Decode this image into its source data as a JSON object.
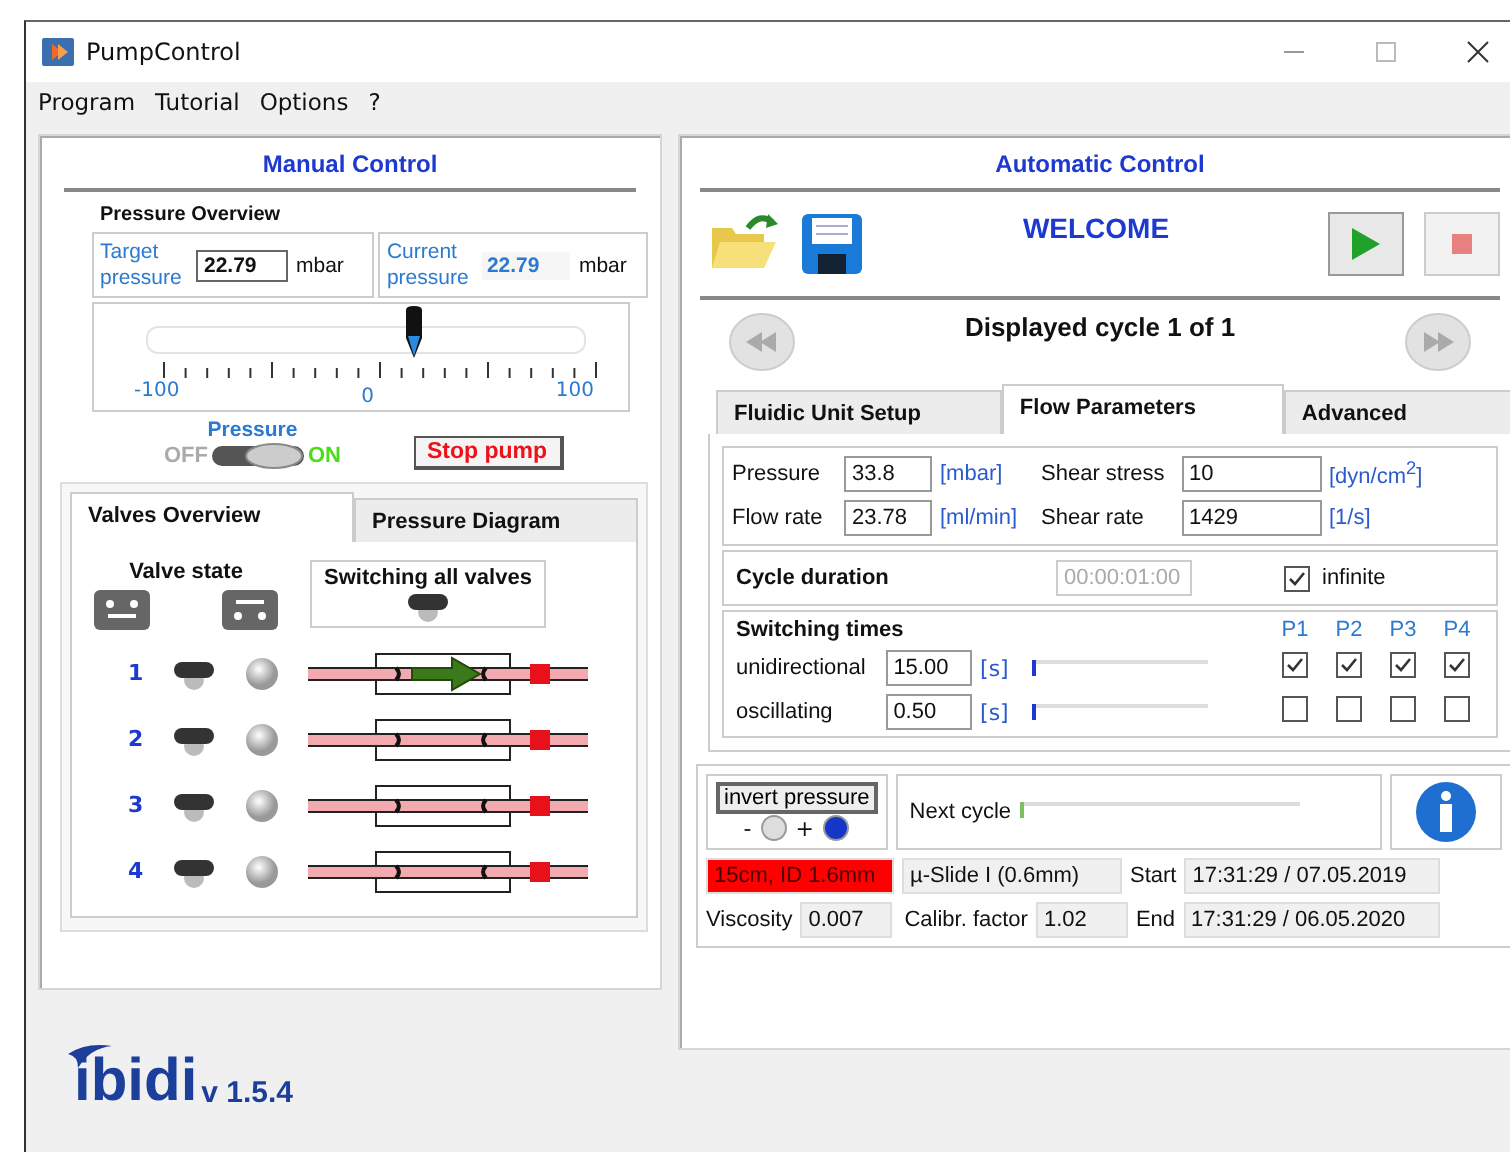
{
  "window": {
    "title": "PumpControl"
  },
  "menu": [
    "Program",
    "Tutorial",
    "Options",
    "?"
  ],
  "manual": {
    "title": "Manual Control",
    "heading": "Pressure Overview",
    "target": {
      "label": "Target pressure",
      "value": "22.79",
      "unit": "mbar"
    },
    "current": {
      "label": "Current pressure",
      "value": "22.79",
      "unit": "mbar"
    },
    "slider": {
      "level": 0.61,
      "ticks": [
        "-100",
        "0",
        "100"
      ]
    },
    "pressure_switch": {
      "label": "Pressure",
      "off": "OFF",
      "on": "ON",
      "selected": true
    },
    "stop_button": "Stop pump",
    "tabs": [
      {
        "label": "Valves Overview",
        "selected": true
      },
      {
        "label": "Pressure Diagram",
        "selected": false
      }
    ],
    "valve_heading": "Valve state",
    "switch_all_label": "Switching all valves",
    "switch_all_on": false,
    "valves": [
      {
        "number": "1",
        "on": false,
        "flow": true
      },
      {
        "number": "2",
        "on": false,
        "flow": false
      },
      {
        "number": "3",
        "on": false,
        "flow": false
      },
      {
        "number": "4",
        "on": false,
        "flow": false
      }
    ]
  },
  "auto": {
    "title": "Automatic Control",
    "welcome": "WELCOME",
    "cycle": "Displayed cycle 1 of 1",
    "tabs": [
      {
        "label": "Fluidic Unit Setup",
        "selected": false
      },
      {
        "label": "Flow Parameters",
        "selected": true
      },
      {
        "label": "Advanced",
        "selected": false
      }
    ],
    "params_left": [
      {
        "label": "Pressure",
        "value": "33.8",
        "unit": "[mbar]"
      },
      {
        "label": "Flow rate",
        "value": "23.78",
        "unit": "[ml/min]"
      }
    ],
    "params_right": [
      {
        "label": "Shear stress",
        "value": "10",
        "unit": "[dyn/cm$^{2}$]"
      },
      {
        "label": "Shear rate",
        "value": "1429",
        "unit": "[1/s]"
      }
    ],
    "cycle_duration": {
      "label": "Cycle duration",
      "value": "00:00:01:00",
      "disabled": true,
      "infinite_label": "infinite",
      "infinite_checked": true
    },
    "switching": {
      "heading": "Switching times",
      "columns": [
        "P1",
        "P2",
        "P3",
        "P4"
      ],
      "rows": [
        {
          "label": "unidirectional",
          "value": "15.00",
          "unit": "[s]",
          "level": 0.02,
          "checks": [
            true,
            true,
            true,
            true
          ]
        },
        {
          "label": "oscillating",
          "value": "0.50",
          "unit": "[s]",
          "level": 0.02,
          "checks": [
            false,
            false,
            false,
            false
          ]
        }
      ]
    },
    "invert": {
      "label": "invert pressure",
      "minus": "-",
      "plus": "+",
      "positive": true
    },
    "next_cycle": {
      "label": "Next cycle",
      "level": 0.01
    },
    "tubing": "15cm, ID 1.6mm",
    "slide": "µ-Slide I (0.6mm)",
    "start_label": "Start",
    "start": "17:31:29 / 07.05.2019",
    "end_label": "End",
    "end": "17:31:29 / 06.05.2020",
    "viscosity_label": "Viscosity",
    "viscosity": "0.007",
    "calibr_label": "Calibr. factor",
    "calibr": "1.02"
  },
  "logo": {
    "brand": "ibidi",
    "version": "v 1.5.4"
  }
}
